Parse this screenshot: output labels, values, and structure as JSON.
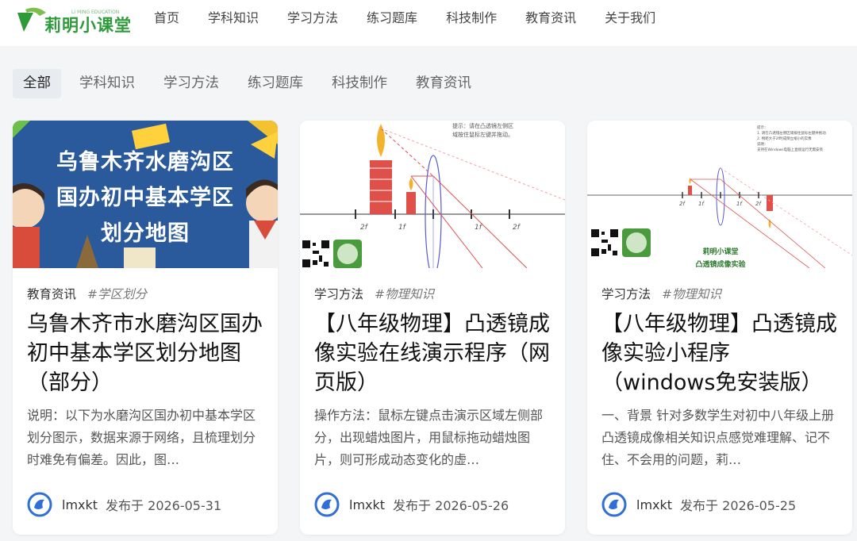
{
  "site": {
    "logo_text": "莉明小课堂",
    "logo_sub": "LI MING EDUCATION"
  },
  "nav": {
    "items": [
      "首页",
      "学科知识",
      "学习方法",
      "练习题库",
      "科技制作",
      "教育资讯",
      "关于我们"
    ]
  },
  "filters": {
    "items": [
      "全部",
      "学科知识",
      "学习方法",
      "练习题库",
      "科技制作",
      "教育资讯"
    ],
    "active": "全部"
  },
  "cards": [
    {
      "banner_lines": [
        "乌鲁木齐水磨沟区",
        "国办初中基本学区",
        "划分地图"
      ],
      "category": "教育资讯",
      "tag": "#学区划分",
      "title": "乌鲁木齐市水磨沟区国办初中基本学区划分地图（部分）",
      "excerpt": "说明：以下为水磨沟区国办初中基本学区划分图示，数据来源于网络，且梳理划分时难免有偏差。因此，图…",
      "author": "lmxkt",
      "date": "发布于 2026-05-31"
    },
    {
      "hint": "提示：请在凸透镜左侧区域按住鼠标左键并拖动。",
      "category": "学习方法",
      "tag": "#物理知识",
      "title": "【八年级物理】凸透镜成像实验在线演示程序（网页版）",
      "excerpt": "操作方法：鼠标左键点击演示区域左侧部分，出现蜡烛图片，用鼠标拖动蜡烛图片，则可形成动态变化的虚…",
      "author": "lmxkt",
      "date": "发布于 2026-05-26",
      "axis_labels": [
        "2f",
        "1f",
        "1f",
        "2f"
      ]
    },
    {
      "hint_lines": [
        "提示：",
        "1. 请在凸透镜左侧区域按住鼠标左键并拖动",
        "2. 物距大于2f时成倒立缩小的实像",
        "说明：",
        "支持在Windows电脑上直接运行无需安装"
      ],
      "brand_lines": [
        "莉明小课堂",
        "凸透镜成像实验"
      ],
      "category": "学习方法",
      "tag": "#物理知识",
      "title": "【八年级物理】凸透镜成像实验小程序（windows免安装版）",
      "excerpt": "一、背景 针对多数学生对初中八年级上册凸透镜成像相关知识点感觉难理解、记不住、不会用的问题，莉…",
      "author": "lmxkt",
      "date": "发布于 2026-05-25",
      "axis_labels": [
        "2f",
        "1f",
        "1f",
        "2f"
      ]
    }
  ],
  "colors": {
    "brand_green": "#2e9a3a",
    "banner_blue": "#2a5a9c",
    "avatar_blue": "#2f6fd6"
  }
}
